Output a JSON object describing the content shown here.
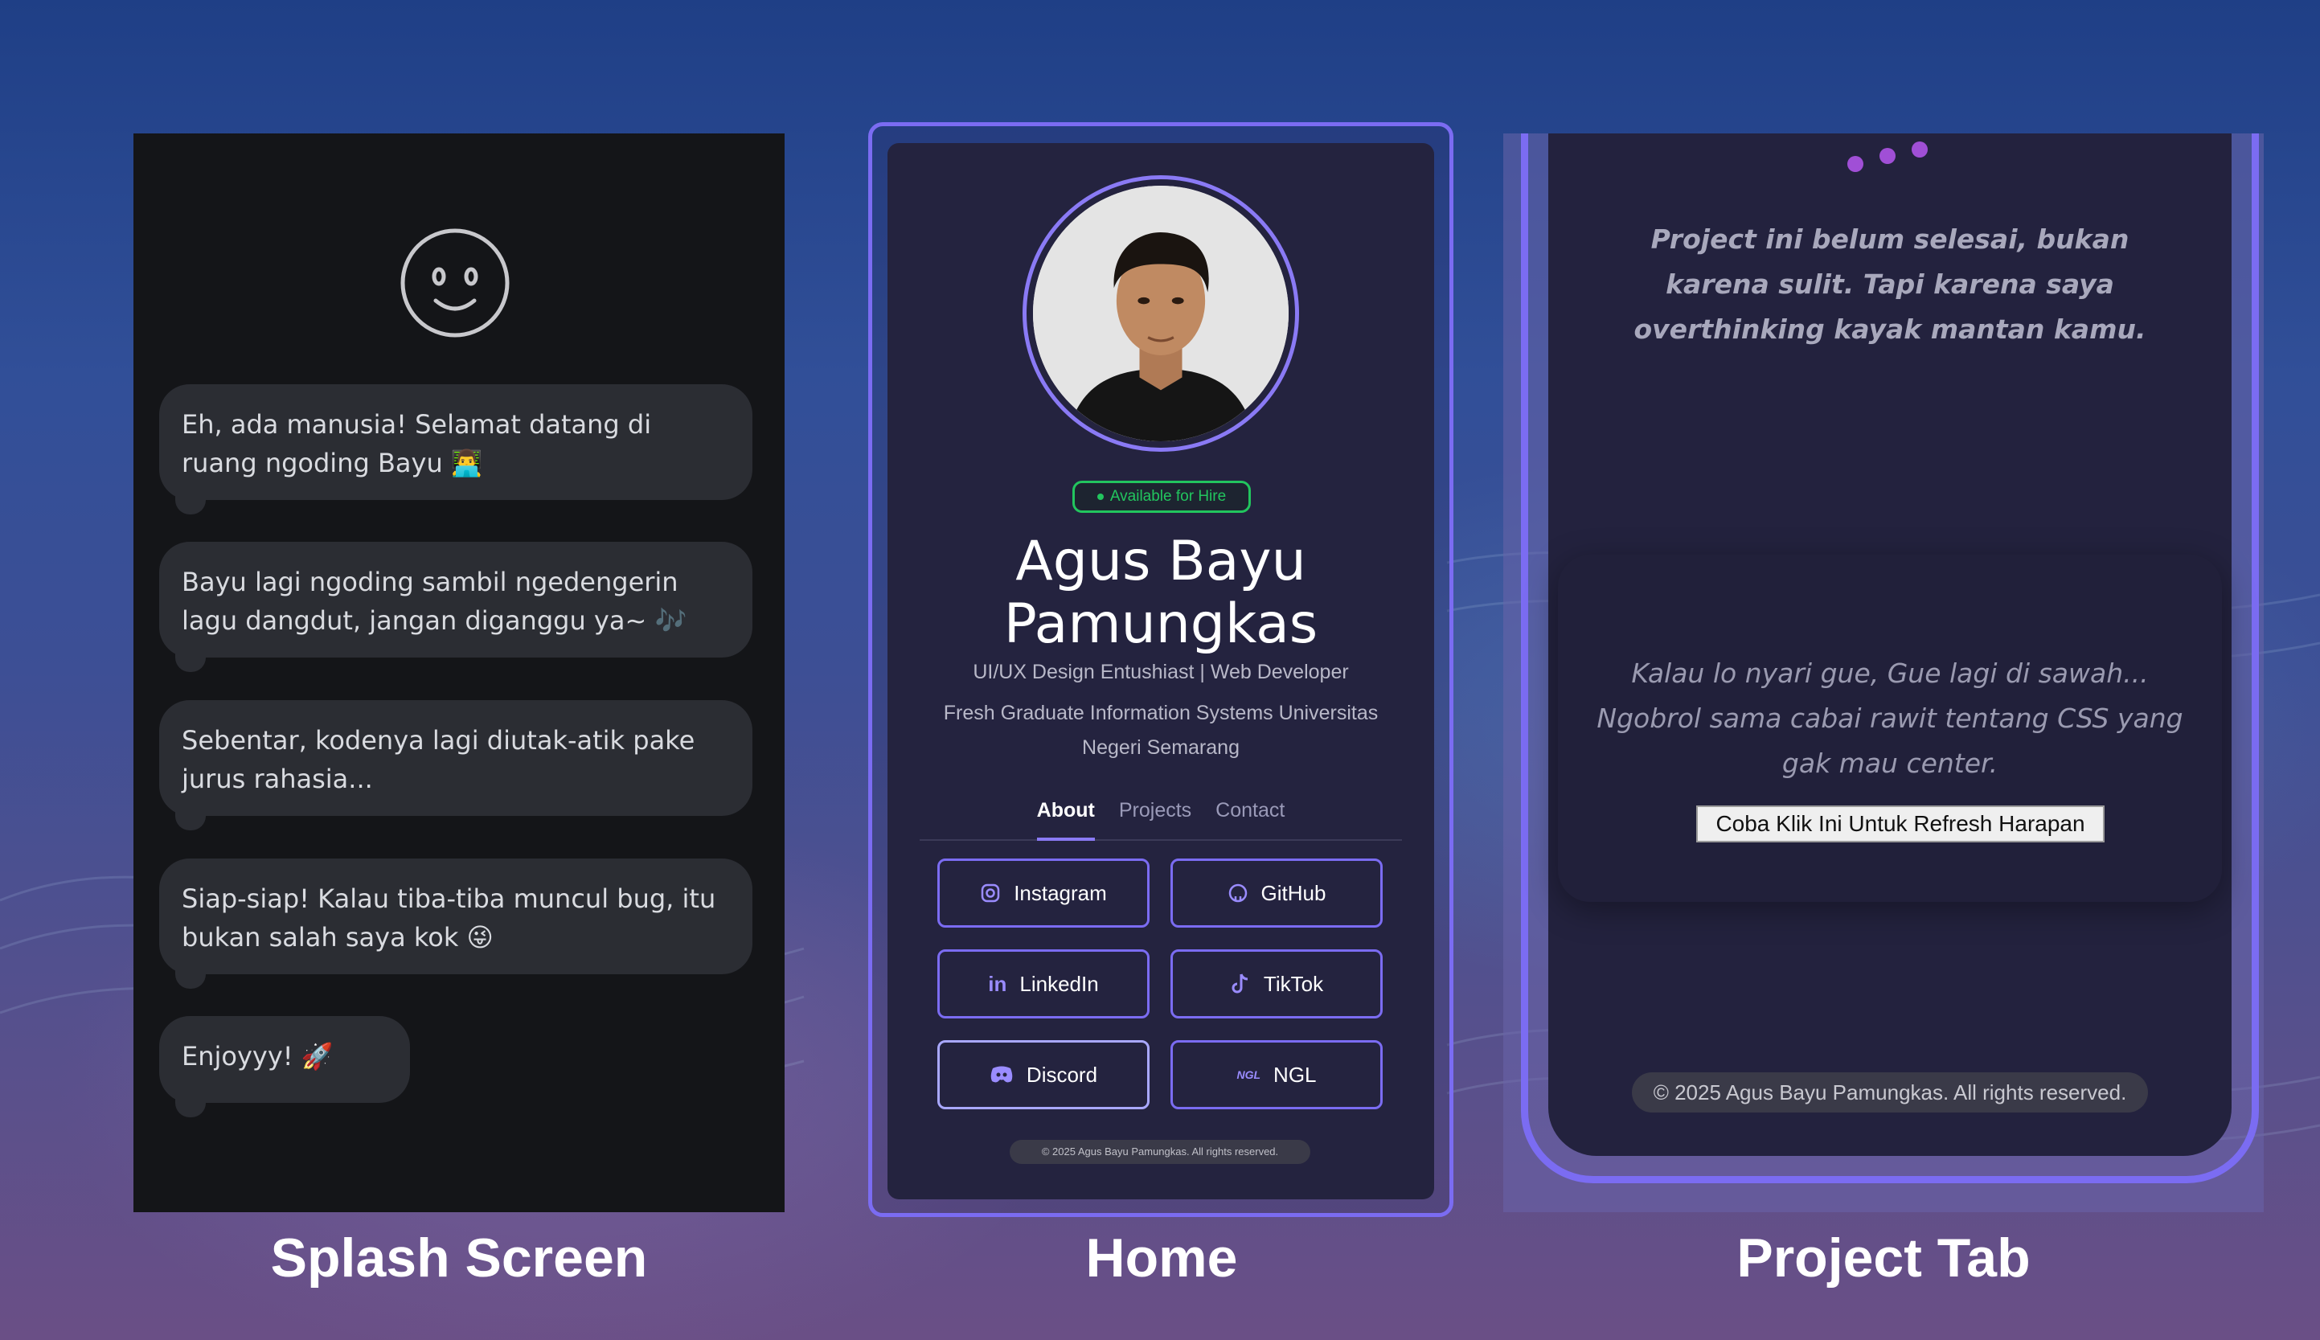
{
  "splash": {
    "messages": [
      "Eh, ada manusia! Selamat datang di ruang ngoding Bayu 👨‍💻",
      "Bayu lagi ngoding sambil ngedengerin lagu dangdut, jangan diganggu ya~ 🎶",
      "Sebentar, kodenya lagi diutak-atik pake jurus rahasia...",
      "Siap-siap! Kalau tiba-tiba muncul bug, itu bukan salah saya kok 😜",
      "Enjoyyy! 🚀"
    ],
    "caption": "Splash Screen"
  },
  "home": {
    "badge": "Available for Hire",
    "name": "Agus Bayu Pamungkas",
    "role": "UI/UX Design Entushiast | Web Developer",
    "education": "Fresh Graduate Information Systems Universitas Negeri Semarang",
    "tabs": [
      "About",
      "Projects",
      "Contact"
    ],
    "active_tab": "About",
    "socials": [
      {
        "label": "Instagram",
        "icon": "instagram-icon"
      },
      {
        "label": "GitHub",
        "icon": "github-icon"
      },
      {
        "label": "LinkedIn",
        "icon": "linkedin-icon"
      },
      {
        "label": "TikTok",
        "icon": "tiktok-icon"
      },
      {
        "label": "Discord",
        "icon": "discord-icon"
      },
      {
        "label": "NGL",
        "icon": "ngl-icon"
      }
    ],
    "footer": "© 2025 Agus Bayu Pamungkas. All rights reserved.",
    "caption": "Home"
  },
  "project": {
    "quote1": "Project ini belum selesai, bukan karena sulit. Tapi karena saya overthinking kayak mantan kamu.",
    "quote2": "Kalau lo nyari gue, Gue lagi di sawah... Ngobrol sama cabai rawit tentang CSS yang gak mau center.",
    "refresh_button": "Coba Klik Ini Untuk Refresh Harapan",
    "footer": "© 2025 Agus Bayu Pamungkas. All rights reserved.",
    "caption": "Project Tab"
  },
  "colors": {
    "accent": "#7b6cf2",
    "available_green": "#22c55e",
    "card_dark": "#24233f",
    "splash_bg": "#141518",
    "bubble": "#2b2d33",
    "loading_dot": "#a04fd6"
  }
}
